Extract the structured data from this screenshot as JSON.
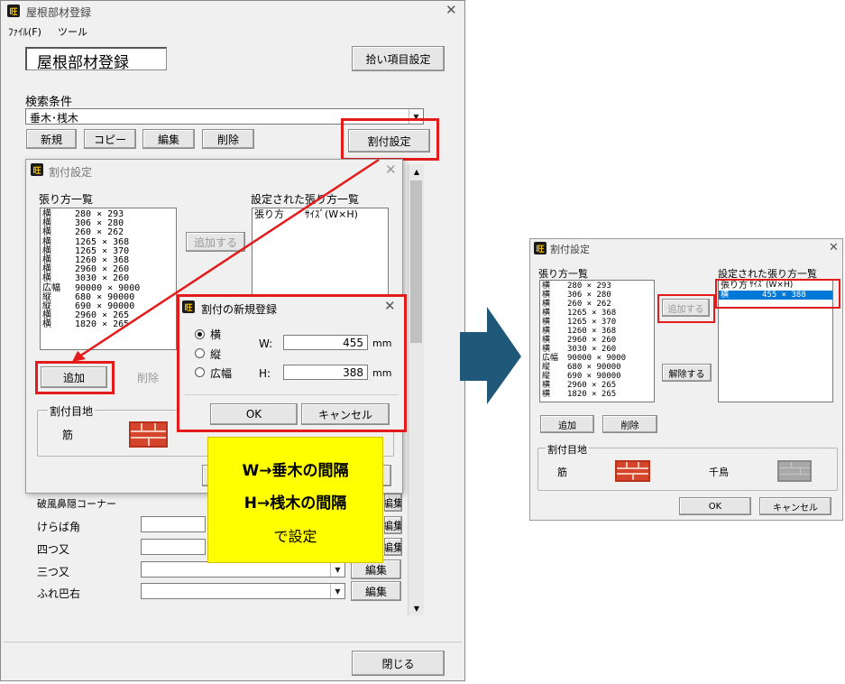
{
  "main_window": {
    "title": "屋根部材登録",
    "menu": [
      "ﾌｧｲﾙ(F)",
      "ツール"
    ],
    "heading": "屋根部材登録",
    "pickup_button": "拾い項目設定",
    "search_label": "検索条件",
    "search_value": "垂木･桟木",
    "toolbar": {
      "new": "新規",
      "copy": "コピー",
      "edit": "編集",
      "delete": "削除",
      "waritsuke": "割付設定"
    },
    "rows": [
      {
        "label": "破風鼻隠コーナー",
        "edit": "編集"
      },
      {
        "label": "けらば角",
        "edit": "編集"
      },
      {
        "label": "四つ又",
        "edit": "編集"
      },
      {
        "label": "三つ又",
        "edit": "編集"
      },
      {
        "label": "ふれ巴右",
        "edit": "編集"
      }
    ],
    "close_button": "閉じる"
  },
  "dialog_left": {
    "title": "割付設定",
    "list_label": "張り方一覧",
    "set_list_label": "設定された張り方一覧",
    "set_header": {
      "type": "張り方",
      "size": "ｻｲｽﾞ(W×H)"
    },
    "items": [
      {
        "type": "横",
        "size": "280 × 293"
      },
      {
        "type": "横",
        "size": "306 × 280"
      },
      {
        "type": "横",
        "size": "260 × 262"
      },
      {
        "type": "横",
        "size": "1265 × 368"
      },
      {
        "type": "横",
        "size": "1265 × 370"
      },
      {
        "type": "横",
        "size": "1260 × 368"
      },
      {
        "type": "横",
        "size": "2960 × 260"
      },
      {
        "type": "横",
        "size": "3030 × 260"
      },
      {
        "type": "広幅",
        "size": "90000 × 9000"
      },
      {
        "type": "縦",
        "size": "680 × 90000"
      },
      {
        "type": "縦",
        "size": "690 × 90000"
      },
      {
        "type": "横",
        "size": "2960 × 265"
      },
      {
        "type": "横",
        "size": "1820 × 265"
      }
    ],
    "add_to_button": "追加する",
    "add_button": "追加",
    "delete_button": "削除",
    "joint_group": "割付目地",
    "joint_type": "筋"
  },
  "new_dialog": {
    "title": "割付の新規登録",
    "options": [
      "横",
      "縦",
      "広幅"
    ],
    "selected": "横",
    "w_label": "W:",
    "w_value": "455",
    "h_label": "H:",
    "h_value": "388",
    "unit": "mm",
    "ok": "OK",
    "cancel": "キャンセル"
  },
  "note": {
    "line1": "W→垂木の間隔",
    "line2": "H→桟木の間隔",
    "line3": "で設定"
  },
  "dialog_right": {
    "title": "割付設定",
    "list_label": "張り方一覧",
    "set_list_label": "設定された張り方一覧",
    "set_header": {
      "type": "張り方",
      "size": "ｻｲｽﾞ(W×H)"
    },
    "set_item": {
      "type": "横",
      "size": "455 × 388"
    },
    "add_to_button": "追加する",
    "remove_button": "解除する",
    "add_button": "追加",
    "delete_button": "削除",
    "joint_group": "割付目地",
    "joint_suji": "筋",
    "joint_chidori": "千鳥",
    "ok": "OK",
    "cancel": "キャンセル"
  },
  "colors": {
    "highlight_red": "#e31b1b",
    "arrow": "#1f5878",
    "note_yellow": "#ffff00",
    "selection": "#0078d7"
  }
}
